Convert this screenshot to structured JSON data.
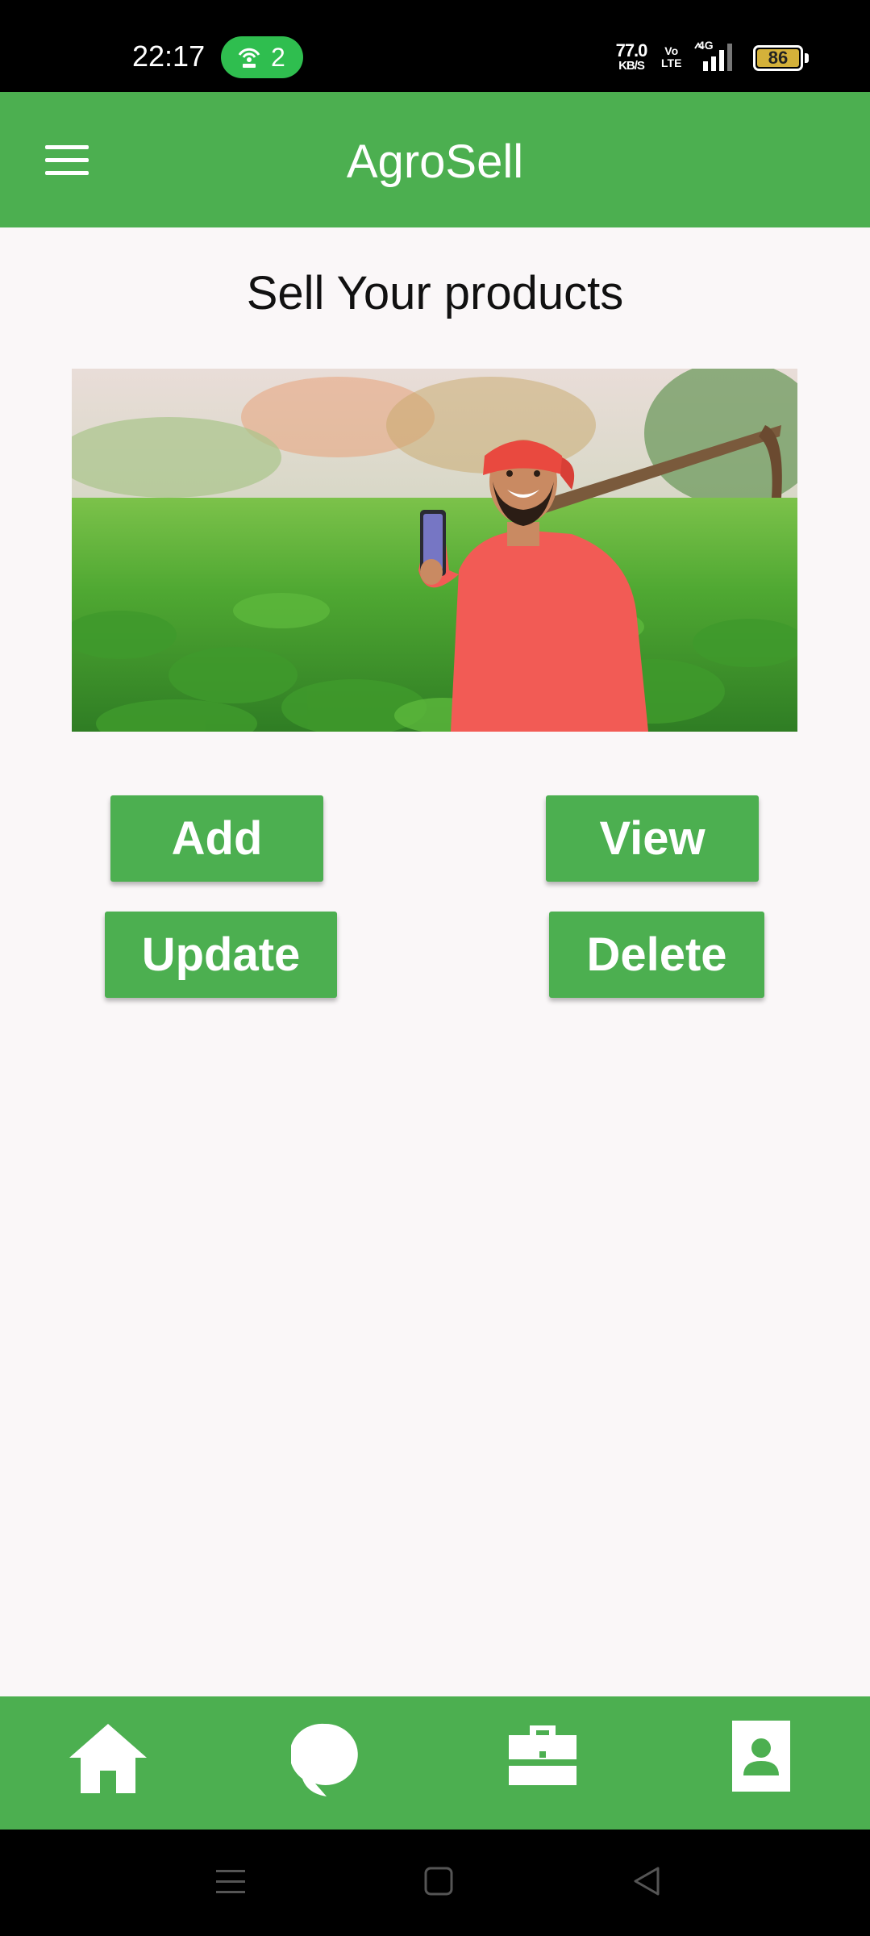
{
  "status_bar": {
    "time": "22:17",
    "hotspot_count": "2",
    "network_speed": "77.0",
    "network_speed_unit": "KB/S",
    "volte_line1": "Vo",
    "volte_line2": "LTE",
    "network_type": "4G",
    "battery_level": "86",
    "battery_color": "#d4b13a",
    "icons": [
      "hotspot-icon",
      "volte-icon",
      "signal-icon",
      "battery-icon"
    ]
  },
  "app_bar": {
    "title": "AgroSell",
    "menu_icon": "hamburger-menu-icon",
    "background_color": "#4caf50"
  },
  "main": {
    "heading": "Sell Your products",
    "hero_image": "farmer-holding-phone-in-field",
    "buttons": {
      "add": "Add",
      "view": "View",
      "update": "Update",
      "delete": "Delete"
    },
    "button_color": "#4caf50"
  },
  "bottom_nav": {
    "items": [
      {
        "icon": "home-icon"
      },
      {
        "icon": "chat-icon"
      },
      {
        "icon": "briefcase-icon"
      },
      {
        "icon": "profile-icon"
      }
    ]
  },
  "system_nav": {
    "icons": [
      "recent-apps-icon",
      "home-square-icon",
      "back-triangle-icon"
    ]
  }
}
